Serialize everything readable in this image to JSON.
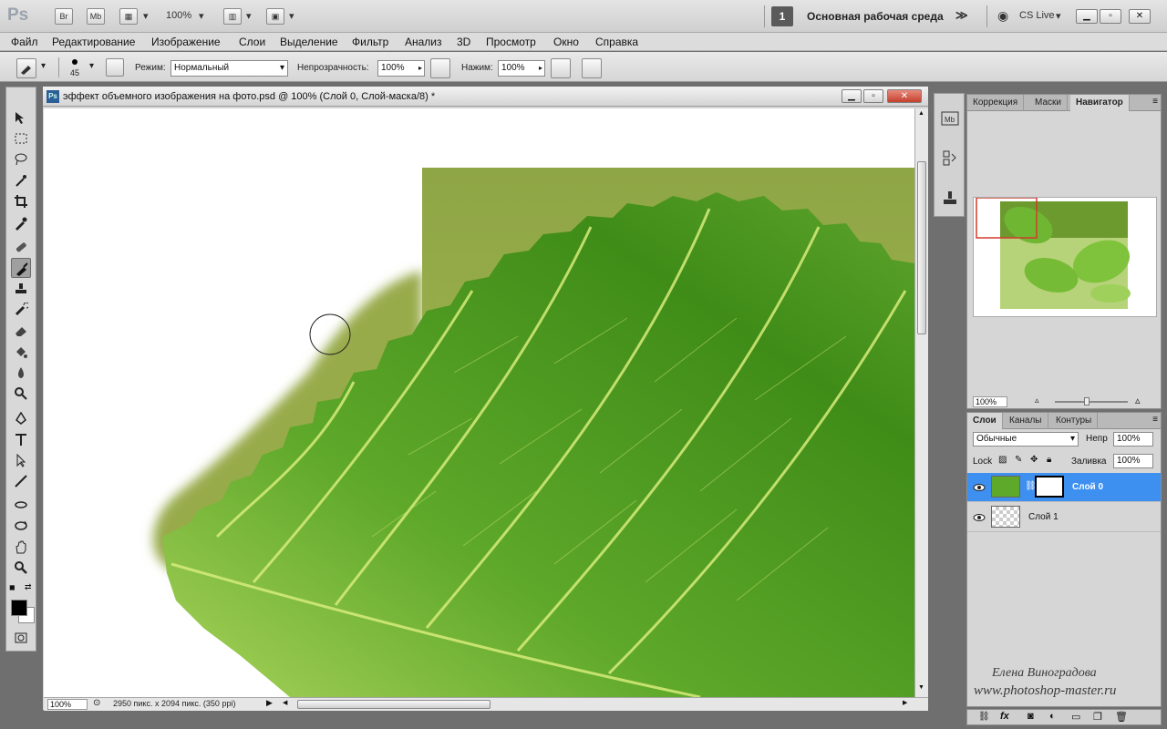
{
  "appbar": {
    "logo": "Ps",
    "bridge_label": "Br",
    "minibridge_label": "Mb",
    "zoom": "100%",
    "workspace_number": "1",
    "workspace_name": "Основная рабочая среда",
    "cs_live": "CS Live"
  },
  "menu": [
    "Файл",
    "Редактирование",
    "Изображение",
    "Слои",
    "Выделение",
    "Фильтр",
    "Анализ",
    "3D",
    "Просмотр",
    "Окно",
    "Справка"
  ],
  "options": {
    "brush_size": "45",
    "mode_label": "Режим:",
    "mode_value": "Нормальный",
    "opacity_label": "Непрозрачность:",
    "opacity_value": "100%",
    "flow_label": "Нажим:",
    "flow_value": "100%"
  },
  "document": {
    "title": "эффект объемного изображения на фото.psd @ 100% (Слой 0, Слой-маска/8) *",
    "zoom": "100%",
    "info": "2950 пикс. x 2094 пикс. (350 ppi)"
  },
  "nav_panel": {
    "tabs": [
      "Коррекция",
      "Маски",
      "Навигатор"
    ],
    "active_tab": "Навигатор",
    "zoom": "100%"
  },
  "layers_panel": {
    "tabs": [
      "Слои",
      "Каналы",
      "Контуры"
    ],
    "blend_mode": "Обычные",
    "opacity_label": "Непр",
    "opacity_value": "100%",
    "lock_label": "Lock",
    "fill_label": "Заливка",
    "fill_value": "100%",
    "layers": [
      {
        "name": "Слой 0",
        "selected": true
      },
      {
        "name": "Слой 1",
        "selected": false
      }
    ]
  },
  "watermark": {
    "author": "Елена Виноградова",
    "site": "www.photoshop-master.ru"
  },
  "colors": {
    "selection": "#3d8ff0",
    "leaf_green": "#4f9a1f",
    "leaf_bg": "#97ad4a"
  }
}
